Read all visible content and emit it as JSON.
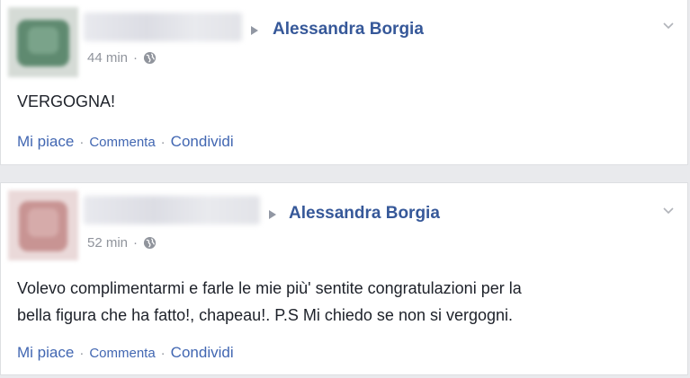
{
  "posts": [
    {
      "target": "Alessandra Borgia",
      "time": "44 min",
      "dot": "·",
      "text": "VERGOGNA!",
      "actions": {
        "like": "Mi piace",
        "comment": "Commenta",
        "share": "Condividi",
        "sep": "·"
      }
    },
    {
      "target": "Alessandra Borgia",
      "time": "52 min",
      "dot": "·",
      "text_lines": [
        "Volevo complimentarmi e farle le mie più' sentite congratulazioni per la",
        "bella figura che ha fatto!, chapeau!. P.S Mi chiedo se non si vergogni."
      ],
      "actions": {
        "like": "Mi piace",
        "comment": "Commenta",
        "share": "Condividi",
        "sep": "·"
      }
    }
  ],
  "colors": {
    "link": "#365899",
    "action": "#4267b2",
    "meta": "#90949c",
    "text": "#1d2129",
    "background": "#e9eaed"
  },
  "icons": [
    "globe-icon",
    "chevron-down-icon",
    "triangle-arrow-icon"
  ]
}
